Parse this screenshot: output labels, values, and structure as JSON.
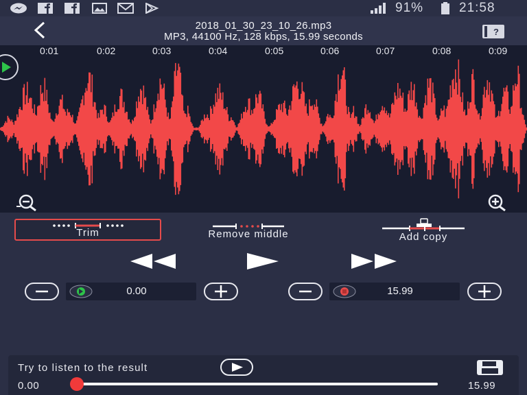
{
  "status_bar": {
    "battery_percent": "91%",
    "clock": "21:58",
    "icons": [
      "messenger-icon",
      "facebook-icon",
      "facebook-icon",
      "gallery-icon",
      "email-icon",
      "play-store-icon",
      "signal-icon",
      "battery-icon"
    ]
  },
  "header": {
    "file_name": "2018_01_30_23_10_26.mp3",
    "file_info": "MP3, 44100 Hz, 128 kbps, 15.99 seconds",
    "back_icon": "back-arrow-icon",
    "help_icon": "help-book-icon"
  },
  "waveform": {
    "color": "#f24848",
    "background": "#181c2e",
    "ticks": [
      "0:01",
      "0:02",
      "0:03",
      "0:04",
      "0:05",
      "0:06",
      "0:07",
      "0:08",
      "0:09"
    ]
  },
  "modes": {
    "trim_label": "Trim",
    "remove_middle_label": "Remove middle",
    "add_copy_label": "Add copy",
    "selected": "Trim",
    "accent": "#e64b4b"
  },
  "transport": {
    "rewind_icon": "rewind-icon",
    "play_icon": "play-icon",
    "fast_forward_icon": "fast-forward-icon"
  },
  "start_marker": {
    "value": "0.00",
    "color": "#2ec44a"
  },
  "end_marker": {
    "value": "15.99",
    "color": "#e64b4b"
  },
  "result": {
    "prompt": "Try to listen to the result",
    "start_time": "0.00",
    "end_time": "15.99",
    "progress": 0.0
  }
}
